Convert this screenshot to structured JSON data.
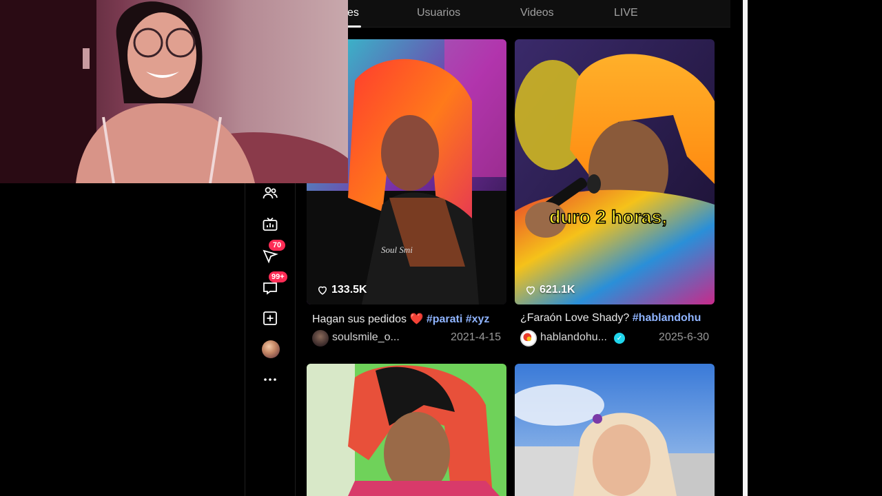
{
  "tabs": [
    {
      "label": "es",
      "active": true
    },
    {
      "label": "Usuarios",
      "active": false
    },
    {
      "label": "Videos",
      "active": false
    },
    {
      "label": "LIVE",
      "active": false
    }
  ],
  "rail": {
    "icons": [
      "following-icon",
      "live-tv-icon",
      "messages-icon",
      "inbox-icon",
      "upload-icon",
      "profile-avatar",
      "more-icon"
    ],
    "badges": {
      "messages": "70",
      "inbox": "99+"
    }
  },
  "videos": [
    {
      "likes": "133.5K",
      "caption": "Hagan sus pedidos",
      "emoji": "❤️",
      "tags": [
        "#parati",
        "#xyz"
      ],
      "username": "soulsmile_o...",
      "date": "2021-4-15",
      "watermark": "Soul Smi",
      "verified": false
    },
    {
      "likes": "621.1K",
      "caption": "¿Faraón Love Shady?",
      "tags": [
        "#hablandohu"
      ],
      "username": "hablandohu...",
      "date": "2025-6-30",
      "overlay_text": "duro 2 horas,",
      "verified": true
    }
  ],
  "colors": {
    "accent": "#fe2c55",
    "hashtag": "#8fb4ff",
    "verified": "#20d5ec",
    "background": "#000000"
  }
}
